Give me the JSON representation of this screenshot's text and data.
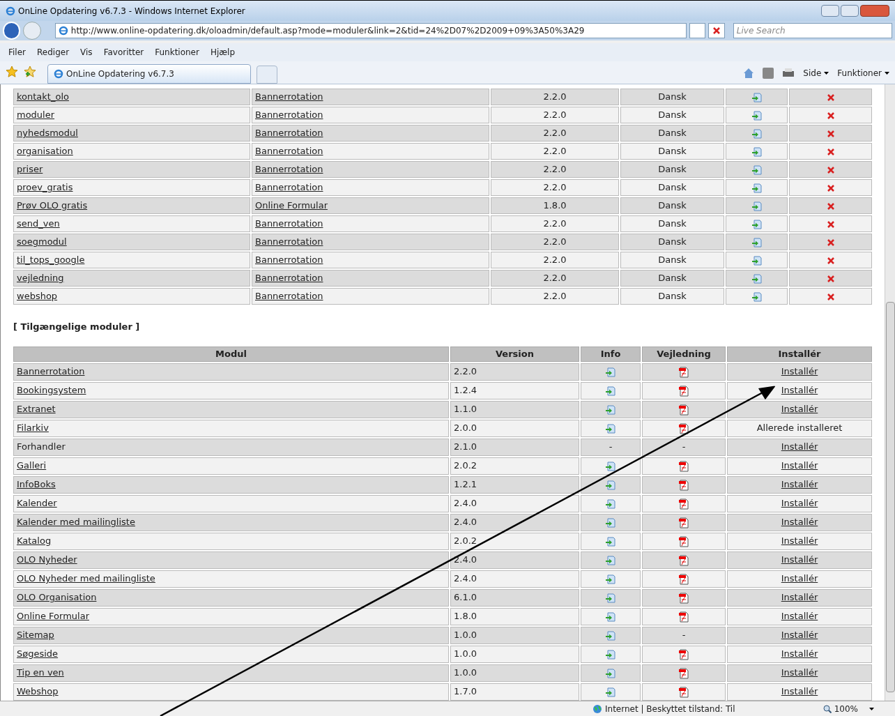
{
  "window": {
    "title": "OnLine Opdatering v6.7.3 - Windows Internet Explorer"
  },
  "address_bar": {
    "url": "http://www.online-opdatering.dk/oloadmin/default.asp?mode=moduler&link=2&tid=24%2D07%2D2009+09%3A50%3A29"
  },
  "search": {
    "placeholder": "Live Search"
  },
  "menu": [
    "Filer",
    "Rediger",
    "Vis",
    "Favoritter",
    "Funktioner",
    "Hjælp"
  ],
  "tab": {
    "title": "OnLine Opdatering v6.7.3"
  },
  "command_bar": [
    "Side",
    "Funktioner"
  ],
  "installed_rows": [
    {
      "name": "kontakt_olo",
      "module": "Bannerrotation",
      "version": "2.2.0",
      "language": "Dansk"
    },
    {
      "name": "moduler",
      "module": "Bannerrotation",
      "version": "2.2.0",
      "language": "Dansk"
    },
    {
      "name": "nyhedsmodul",
      "module": "Bannerrotation",
      "version": "2.2.0",
      "language": "Dansk"
    },
    {
      "name": "organisation",
      "module": "Bannerrotation",
      "version": "2.2.0",
      "language": "Dansk"
    },
    {
      "name": "priser",
      "module": "Bannerrotation",
      "version": "2.2.0",
      "language": "Dansk"
    },
    {
      "name": "proev_gratis",
      "module": "Bannerrotation",
      "version": "2.2.0",
      "language": "Dansk"
    },
    {
      "name": "Prøv OLO gratis",
      "module": "Online Formular",
      "version": "1.8.0",
      "language": "Dansk"
    },
    {
      "name": "send_ven",
      "module": "Bannerrotation",
      "version": "2.2.0",
      "language": "Dansk"
    },
    {
      "name": "soegmodul",
      "module": "Bannerrotation",
      "version": "2.2.0",
      "language": "Dansk"
    },
    {
      "name": "til_tops_google",
      "module": "Bannerrotation",
      "version": "2.2.0",
      "language": "Dansk"
    },
    {
      "name": "vejledning",
      "module": "Bannerrotation",
      "version": "2.2.0",
      "language": "Dansk"
    },
    {
      "name": "webshop",
      "module": "Bannerrotation",
      "version": "2.2.0",
      "language": "Dansk"
    }
  ],
  "available": {
    "heading": "[ Tilgængelige moduler ]",
    "columns": [
      "Modul",
      "Version",
      "Info",
      "Vejledning",
      "Installér"
    ],
    "rows": [
      {
        "name": "Bannerrotation",
        "linked": true,
        "version": "2.2.0",
        "info": {
          "kind": "icon"
        },
        "guide": {
          "kind": "icon"
        },
        "install": {
          "kind": "link",
          "text": "Installér"
        }
      },
      {
        "name": "Bookingsystem",
        "linked": true,
        "version": "1.2.4",
        "info": {
          "kind": "icon"
        },
        "guide": {
          "kind": "icon"
        },
        "install": {
          "kind": "link",
          "text": "Installér"
        }
      },
      {
        "name": "Extranet",
        "linked": true,
        "version": "1.1.0",
        "info": {
          "kind": "icon"
        },
        "guide": {
          "kind": "icon"
        },
        "install": {
          "kind": "link",
          "text": "Installér"
        }
      },
      {
        "name": "Filarkiv",
        "linked": true,
        "version": "2.0.0",
        "info": {
          "kind": "icon"
        },
        "guide": {
          "kind": "icon"
        },
        "install": {
          "kind": "text",
          "text": "Allerede installeret"
        }
      },
      {
        "name": "Forhandler",
        "linked": false,
        "version": "2.1.0",
        "info": {
          "kind": "text",
          "text": "-"
        },
        "guide": {
          "kind": "text",
          "text": "-"
        },
        "install": {
          "kind": "link",
          "text": "Installér"
        }
      },
      {
        "name": "Galleri",
        "linked": true,
        "version": "2.0.2",
        "info": {
          "kind": "icon"
        },
        "guide": {
          "kind": "icon"
        },
        "install": {
          "kind": "link",
          "text": "Installér"
        }
      },
      {
        "name": "InfoBoks",
        "linked": true,
        "version": "1.2.1",
        "info": {
          "kind": "icon"
        },
        "guide": {
          "kind": "icon"
        },
        "install": {
          "kind": "link",
          "text": "Installér"
        }
      },
      {
        "name": "Kalender",
        "linked": true,
        "version": "2.4.0",
        "info": {
          "kind": "icon"
        },
        "guide": {
          "kind": "icon"
        },
        "install": {
          "kind": "link",
          "text": "Installér"
        }
      },
      {
        "name": "Kalender med mailingliste",
        "linked": true,
        "version": "2.4.0",
        "info": {
          "kind": "icon"
        },
        "guide": {
          "kind": "icon"
        },
        "install": {
          "kind": "link",
          "text": "Installér"
        }
      },
      {
        "name": "Katalog",
        "linked": true,
        "version": "2.0.2",
        "info": {
          "kind": "icon"
        },
        "guide": {
          "kind": "icon"
        },
        "install": {
          "kind": "link",
          "text": "Installér"
        }
      },
      {
        "name": "OLO Nyheder",
        "linked": true,
        "version": "2.4.0",
        "info": {
          "kind": "icon"
        },
        "guide": {
          "kind": "icon"
        },
        "install": {
          "kind": "link",
          "text": "Installér"
        }
      },
      {
        "name": "OLO Nyheder med mailingliste",
        "linked": true,
        "version": "2.4.0",
        "info": {
          "kind": "icon"
        },
        "guide": {
          "kind": "icon"
        },
        "install": {
          "kind": "link",
          "text": "Installér"
        }
      },
      {
        "name": "OLO Organisation",
        "linked": true,
        "version": "6.1.0",
        "info": {
          "kind": "icon"
        },
        "guide": {
          "kind": "icon"
        },
        "install": {
          "kind": "link",
          "text": "Installér"
        }
      },
      {
        "name": "Online Formular",
        "linked": true,
        "version": "1.8.0",
        "info": {
          "kind": "icon"
        },
        "guide": {
          "kind": "icon"
        },
        "install": {
          "kind": "link",
          "text": "Installér"
        }
      },
      {
        "name": "Sitemap",
        "linked": true,
        "version": "1.0.0",
        "info": {
          "kind": "icon"
        },
        "guide": {
          "kind": "text",
          "text": "-"
        },
        "install": {
          "kind": "link",
          "text": "Installér"
        }
      },
      {
        "name": "Søgeside",
        "linked": true,
        "version": "1.0.0",
        "info": {
          "kind": "icon"
        },
        "guide": {
          "kind": "icon"
        },
        "install": {
          "kind": "link",
          "text": "Installér"
        }
      },
      {
        "name": "Tip en ven",
        "linked": true,
        "version": "1.0.0",
        "info": {
          "kind": "icon"
        },
        "guide": {
          "kind": "icon"
        },
        "install": {
          "kind": "link",
          "text": "Installér"
        }
      },
      {
        "name": "Webshop",
        "linked": true,
        "version": "1.7.0",
        "info": {
          "kind": "icon"
        },
        "guide": {
          "kind": "icon"
        },
        "install": {
          "kind": "link",
          "text": "Installér"
        }
      }
    ]
  },
  "status_bar": {
    "zone": "Internet | Beskyttet tilstand: Til",
    "zoom": "100%"
  }
}
